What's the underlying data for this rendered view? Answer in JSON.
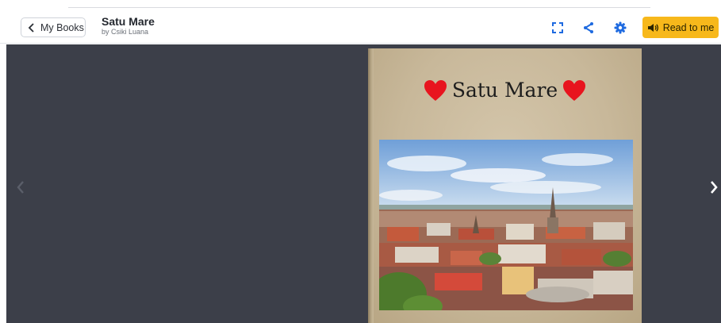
{
  "header": {
    "back_label": "My Books",
    "title": "Satu Mare",
    "author": "by Csiki Luana",
    "read_label": "Read to me"
  },
  "book": {
    "cover_title": "Satu Mare"
  },
  "colors": {
    "accent": "#f7b81b",
    "settings_icon": "#1e6ae0",
    "stage_bg": "#3c3f49",
    "heart": "#e8141e"
  },
  "icons": [
    "chevron-left-icon",
    "fullscreen-icon",
    "share-icon",
    "gear-icon",
    "speaker-icon",
    "arrow-left-icon",
    "arrow-right-icon",
    "heart-icon"
  ]
}
